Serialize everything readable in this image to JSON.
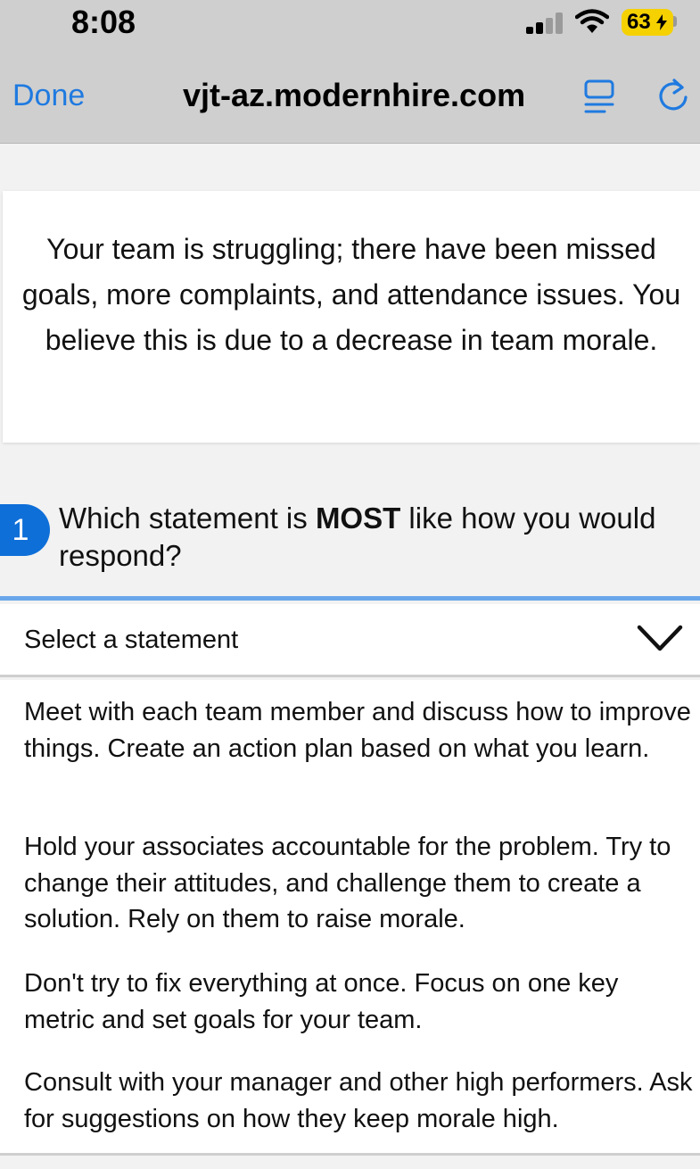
{
  "status_bar": {
    "time": "8:08",
    "battery": "63",
    "battery_color": "#f5d100"
  },
  "nav": {
    "done_label": "Done",
    "url": "vjt-az.modernhire.com",
    "reader_icon": "reader-mode-icon",
    "reload_icon": "reload-icon",
    "accent_color": "#1f7ae0"
  },
  "scenario": {
    "text": "Your team is struggling; there have been missed goals, more complaints, and attendance issues. You believe this is due to a decrease in team morale."
  },
  "question": {
    "number": "1",
    "text_before": "Which statement is ",
    "text_emphasis": "MOST",
    "text_after": " like how you would respond?"
  },
  "select": {
    "placeholder": "Select a statement",
    "icon": "chevron-down-icon"
  },
  "options": [
    "Meet with each team member and discuss how to improve things. Create an action plan based on what you learn.",
    "Hold your associates accountable for the problem. Try to change their attitudes, and challenge them to create a solution. Rely on them to raise morale.",
    "Don't try to fix everything at once. Focus on one key metric and set goals for your team.",
    "Consult with your manager and other high performers. Ask for suggestions on how they keep morale high."
  ]
}
